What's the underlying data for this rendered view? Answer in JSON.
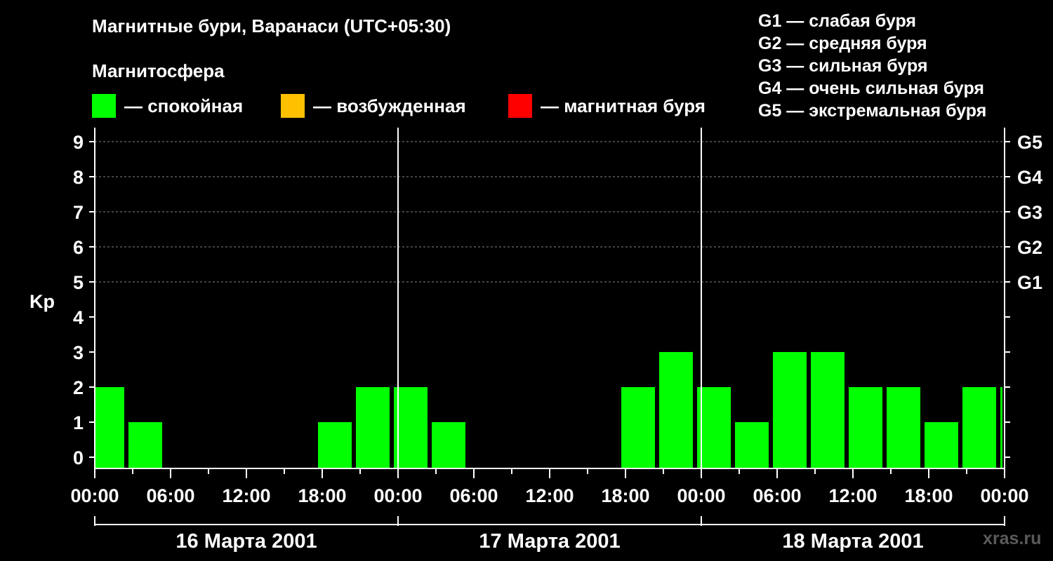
{
  "header": {
    "title": "Магнитные бури, Варанаси (UTC+05:30)",
    "legend_heading": "Магнитосфера"
  },
  "legend": [
    {
      "label": "— спокойная",
      "color": "#00ff00"
    },
    {
      "label": "— возбужденная",
      "color": "#ffc000"
    },
    {
      "label": "— магнитная буря",
      "color": "#ff0000"
    }
  ],
  "storm_scale": [
    "G1 — слабая буря",
    "G2 — средняя буря",
    "G3 — сильная буря",
    "G4 — очень сильная буря",
    "G5 — экстремальная буря"
  ],
  "watermark": "xras.ru",
  "chart_data": {
    "type": "bar",
    "ylabel": "Kp",
    "ylim": [
      0,
      9
    ],
    "y_ticks": [
      0,
      1,
      2,
      3,
      4,
      5,
      6,
      7,
      8,
      9
    ],
    "right_axis_labels": [
      {
        "kp": 5,
        "label": "G1"
      },
      {
        "kp": 6,
        "label": "G2"
      },
      {
        "kp": 7,
        "label": "G3"
      },
      {
        "kp": 8,
        "label": "G4"
      },
      {
        "kp": 9,
        "label": "G5"
      }
    ],
    "x_tick_labels": [
      "00:00",
      "06:00",
      "12:00",
      "18:00",
      "00:00",
      "06:00",
      "12:00",
      "18:00",
      "00:00",
      "06:00",
      "12:00",
      "18:00",
      "00:00"
    ],
    "days": [
      "16 Марта 2001",
      "17 Марта 2001",
      "18 Марта 2001"
    ],
    "grid": "dashed at Kp 5–9",
    "bar_color": "#00ff00",
    "series": [
      {
        "start_hour": 0,
        "end_hour": 2.5,
        "kp": 2
      },
      {
        "start_hour": 2.5,
        "end_hour": 5.5,
        "kp": 1
      },
      {
        "start_hour": 5.5,
        "end_hour": 8.5,
        "kp": 0
      },
      {
        "start_hour": 8.5,
        "end_hour": 11.5,
        "kp": 0
      },
      {
        "start_hour": 11.5,
        "end_hour": 14.5,
        "kp": 0
      },
      {
        "start_hour": 14.5,
        "end_hour": 17.5,
        "kp": 0
      },
      {
        "start_hour": 17.5,
        "end_hour": 20.5,
        "kp": 1
      },
      {
        "start_hour": 20.5,
        "end_hour": 23.5,
        "kp": 2
      },
      {
        "start_hour": 23.5,
        "end_hour": 26.5,
        "kp": 2
      },
      {
        "start_hour": 26.5,
        "end_hour": 29.5,
        "kp": 1
      },
      {
        "start_hour": 29.5,
        "end_hour": 32.5,
        "kp": 0
      },
      {
        "start_hour": 32.5,
        "end_hour": 35.5,
        "kp": 0
      },
      {
        "start_hour": 35.5,
        "end_hour": 38.5,
        "kp": 0
      },
      {
        "start_hour": 38.5,
        "end_hour": 41.5,
        "kp": 0
      },
      {
        "start_hour": 41.5,
        "end_hour": 44.5,
        "kp": 2
      },
      {
        "start_hour": 44.5,
        "end_hour": 47.5,
        "kp": 3
      },
      {
        "start_hour": 47.5,
        "end_hour": 50.5,
        "kp": 2
      },
      {
        "start_hour": 50.5,
        "end_hour": 53.5,
        "kp": 1
      },
      {
        "start_hour": 53.5,
        "end_hour": 56.5,
        "kp": 3
      },
      {
        "start_hour": 56.5,
        "end_hour": 59.5,
        "kp": 3
      },
      {
        "start_hour": 59.5,
        "end_hour": 62.5,
        "kp": 2
      },
      {
        "start_hour": 62.5,
        "end_hour": 65.5,
        "kp": 2
      },
      {
        "start_hour": 65.5,
        "end_hour": 68.5,
        "kp": 1
      },
      {
        "start_hour": 68.5,
        "end_hour": 71.5,
        "kp": 2
      },
      {
        "start_hour": 71.5,
        "end_hour": 72,
        "kp": 2
      }
    ]
  }
}
